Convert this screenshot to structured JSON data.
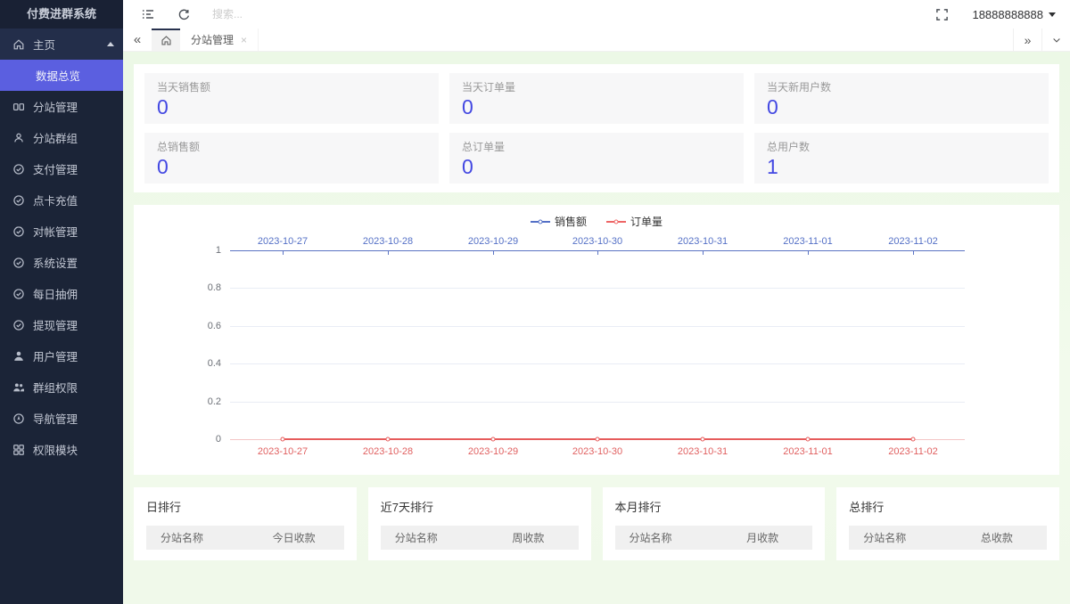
{
  "app": {
    "title": "付费进群系统"
  },
  "topbar": {
    "search_placeholder": "搜索...",
    "user_phone": "18888888888"
  },
  "tabbar": {
    "back_glyph": "«",
    "forward_glyph": "»",
    "tab_label": "分站管理",
    "tab_close_glyph": "×"
  },
  "sidebar": {
    "home_label": "主页",
    "sub_active_label": "数据总览",
    "items": [
      {
        "label": "分站管理"
      },
      {
        "label": "分站群组"
      },
      {
        "label": "支付管理"
      },
      {
        "label": "点卡充值"
      },
      {
        "label": "对帐管理"
      },
      {
        "label": "系统设置"
      },
      {
        "label": "每日抽佣"
      },
      {
        "label": "提现管理"
      },
      {
        "label": "用户管理"
      },
      {
        "label": "群组权限"
      },
      {
        "label": "导航管理"
      },
      {
        "label": "权限模块"
      }
    ]
  },
  "stats": {
    "cards": [
      {
        "label": "当天销售额",
        "value": "0"
      },
      {
        "label": "当天订单量",
        "value": "0"
      },
      {
        "label": "当天新用户数",
        "value": "0"
      },
      {
        "label": "总销售额",
        "value": "0"
      },
      {
        "label": "总订单量",
        "value": "0"
      },
      {
        "label": "总用户数",
        "value": "1"
      }
    ]
  },
  "chart_data": {
    "type": "line",
    "categories": [
      "2023-10-27",
      "2023-10-28",
      "2023-10-29",
      "2023-10-30",
      "2023-10-31",
      "2023-11-01",
      "2023-11-02"
    ],
    "series": [
      {
        "name": "销售额",
        "color": "#5470c6",
        "values": [
          0,
          0,
          0,
          0,
          0,
          0,
          0
        ],
        "x_axis": "top"
      },
      {
        "name": "订单量",
        "color": "#ee6666",
        "values": [
          0,
          0,
          0,
          0,
          0,
          0,
          0
        ],
        "x_axis": "bottom",
        "marker": "hollow-circle"
      }
    ],
    "title": "",
    "xlabel": "",
    "ylabel": "",
    "ylim": [
      0,
      1
    ],
    "yticks": [
      0,
      0.2,
      0.4,
      0.6,
      0.8,
      1
    ],
    "ytick_labels": [
      "1",
      "0.8",
      "0.6",
      "0.4",
      "0.2",
      "0"
    ],
    "dual_x_axis": true,
    "x_axis_top_color": "#5470c6",
    "x_axis_bottom_color": "#ee6666",
    "grid": true,
    "legend_position": "top-center"
  },
  "rankings": [
    {
      "title": "日排行",
      "columns": [
        "分站名称",
        "今日收款"
      ]
    },
    {
      "title": "近7天排行",
      "columns": [
        "分站名称",
        "周收款"
      ]
    },
    {
      "title": "本月排行",
      "columns": [
        "分站名称",
        "月收款"
      ]
    },
    {
      "title": "总排行",
      "columns": [
        "分站名称",
        "总收款"
      ]
    }
  ],
  "colors": {
    "sidebar_bg": "#1b2437",
    "active_menu": "#5b5fe0",
    "stat_value_blue": "#4348e2",
    "series_blue": "#5470c6",
    "series_red": "#ee6666",
    "content_bg_green": "#eef8e9"
  }
}
